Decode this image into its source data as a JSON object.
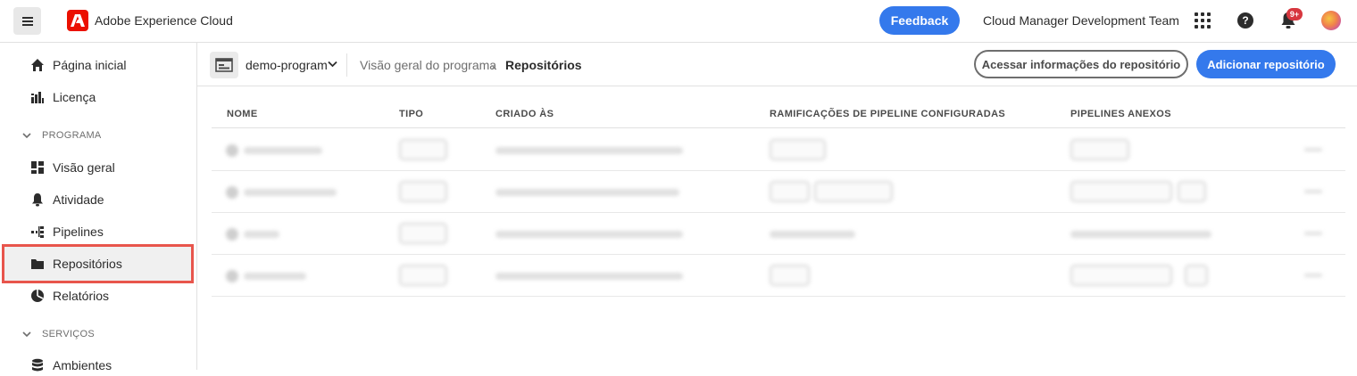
{
  "header": {
    "app_title": "Adobe Experience Cloud",
    "feedback_label": "Feedback",
    "org_name": "Cloud Manager Development Team",
    "notification_badge": "9+"
  },
  "sidebar": {
    "items": [
      {
        "label": "Página inicial",
        "icon": "home-icon"
      },
      {
        "label": "Licença",
        "icon": "license-icon"
      }
    ],
    "sections": [
      {
        "label": "PROGRAMA",
        "items": [
          {
            "label": "Visão geral",
            "icon": "overview-icon"
          },
          {
            "label": "Atividade",
            "icon": "bell-icon"
          },
          {
            "label": "Pipelines",
            "icon": "pipeline-icon"
          },
          {
            "label": "Repositórios",
            "icon": "folder-icon",
            "active": true
          },
          {
            "label": "Relatórios",
            "icon": "pie-chart-icon"
          }
        ]
      },
      {
        "label": "SERVIÇOS",
        "items": [
          {
            "label": "Ambientes",
            "icon": "database-icon"
          }
        ]
      }
    ]
  },
  "breadcrumb": {
    "program": "demo-program",
    "crumbs": [
      "Visão geral do programa",
      "Repositórios"
    ]
  },
  "actions": {
    "repo_info": "Acessar informações do repositório",
    "add_repo": "Adicionar repositório"
  },
  "table": {
    "columns": [
      "NOME",
      "TIPO",
      "CRIADO ÀS",
      "RAMIFICAÇÕES DE PIPELINE CONFIGURADAS",
      "PIPELINES ANEXOS"
    ]
  },
  "colors": {
    "accent": "#3479ec",
    "highlight_border": "#e8554c",
    "adobe_red": "#eb1000"
  }
}
